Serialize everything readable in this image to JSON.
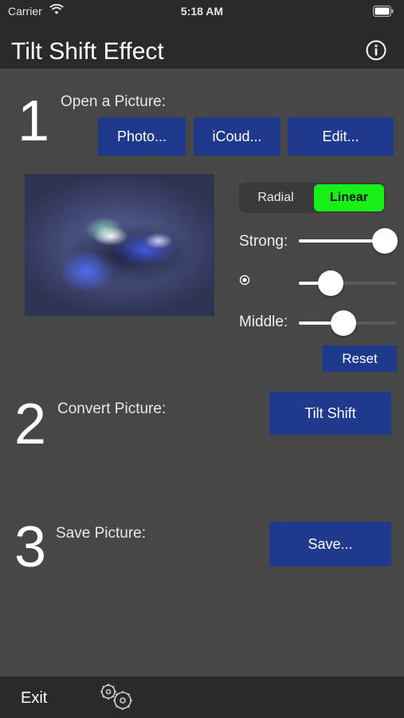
{
  "status_bar": {
    "carrier": "Carrier",
    "time": "5:18 AM"
  },
  "nav": {
    "title": "Tilt Shift Effect",
    "info_icon": "info-circle-icon"
  },
  "step1": {
    "number": "1",
    "label": "Open a Picture:",
    "buttons": {
      "photo": "Photo...",
      "icloud": "iCoud...",
      "edit": "Edit..."
    }
  },
  "effect": {
    "mode_options": [
      "Radial",
      "Linear"
    ],
    "selected_mode": "Linear",
    "strong_label": "Strong:",
    "strong_value": 1.0,
    "center_label_icon": "radio-dot-icon",
    "center_value": 0.33,
    "middle_label": "Middle:",
    "middle_value": 0.46,
    "reset_label": "Reset"
  },
  "step2": {
    "number": "2",
    "label": "Convert Picture:",
    "button": "Tilt Shift"
  },
  "step3": {
    "number": "3",
    "label": "Save Picture:",
    "button": "Save..."
  },
  "toolbar": {
    "exit_label": "Exit",
    "settings_icon": "gears-icon"
  },
  "colors": {
    "background": "#474747",
    "bar": "#2a2a2a",
    "button": "#1f3a8c",
    "segment_selected": "#16f016"
  }
}
